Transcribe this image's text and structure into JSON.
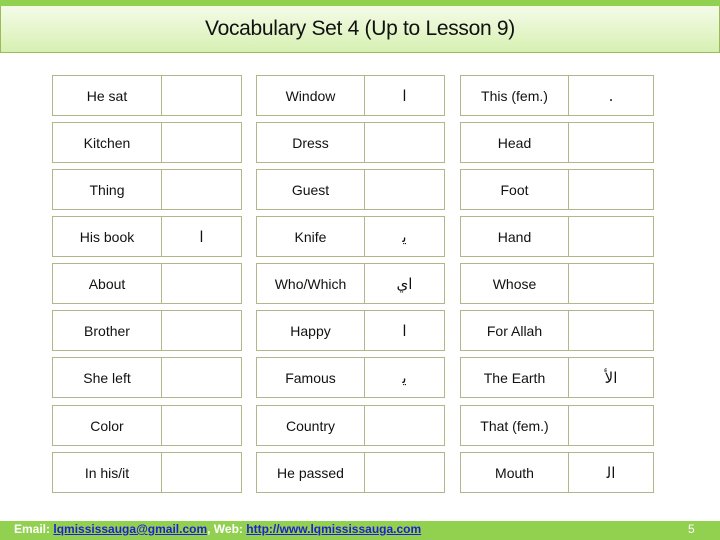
{
  "header": {
    "title": "Vocabulary Set 4 (Up to Lesson 9)"
  },
  "vocabulary": {
    "groups": [
      {
        "rows": [
          {
            "english": "He sat",
            "arabic": ""
          },
          {
            "english": "Kitchen",
            "arabic": ""
          },
          {
            "english": "Thing",
            "arabic": ""
          },
          {
            "english": "His book",
            "arabic": "ا"
          },
          {
            "english": "About",
            "arabic": ""
          },
          {
            "english": "Brother",
            "arabic": ""
          },
          {
            "english": "She left",
            "arabic": ""
          },
          {
            "english": "Color",
            "arabic": ""
          },
          {
            "english": "In his/it",
            "arabic": ""
          }
        ]
      },
      {
        "rows": [
          {
            "english": "Window",
            "arabic": "ا"
          },
          {
            "english": "Dress",
            "arabic": ""
          },
          {
            "english": "Guest",
            "arabic": ""
          },
          {
            "english": "Knife",
            "arabic": "ﯾ"
          },
          {
            "english": "Who/Which",
            "arabic": "اي"
          },
          {
            "english": "Happy",
            "arabic": "ا"
          },
          {
            "english": "Famous",
            "arabic": "ﯾ"
          },
          {
            "english": "Country",
            "arabic": ""
          },
          {
            "english": "He passed",
            "arabic": ""
          }
        ]
      },
      {
        "rows": [
          {
            "english": "This (fem.)",
            "arabic": "."
          },
          {
            "english": "Head",
            "arabic": ""
          },
          {
            "english": "Foot",
            "arabic": ""
          },
          {
            "english": "Hand",
            "arabic": ""
          },
          {
            "english": "Whose",
            "arabic": ""
          },
          {
            "english": "For Allah",
            "arabic": ""
          },
          {
            "english": "The Earth",
            "arabic": "الأ"
          },
          {
            "english": "That (fem.)",
            "arabic": ""
          },
          {
            "english": "Mouth",
            "arabic": "ﺍﻟ"
          }
        ]
      }
    ]
  },
  "footer": {
    "email_label": "Email: ",
    "email": "lqmississauga@gmail.com",
    "separator": ", Web: ",
    "web": "http://www.lqmississauga.com",
    "page_number": "5"
  }
}
